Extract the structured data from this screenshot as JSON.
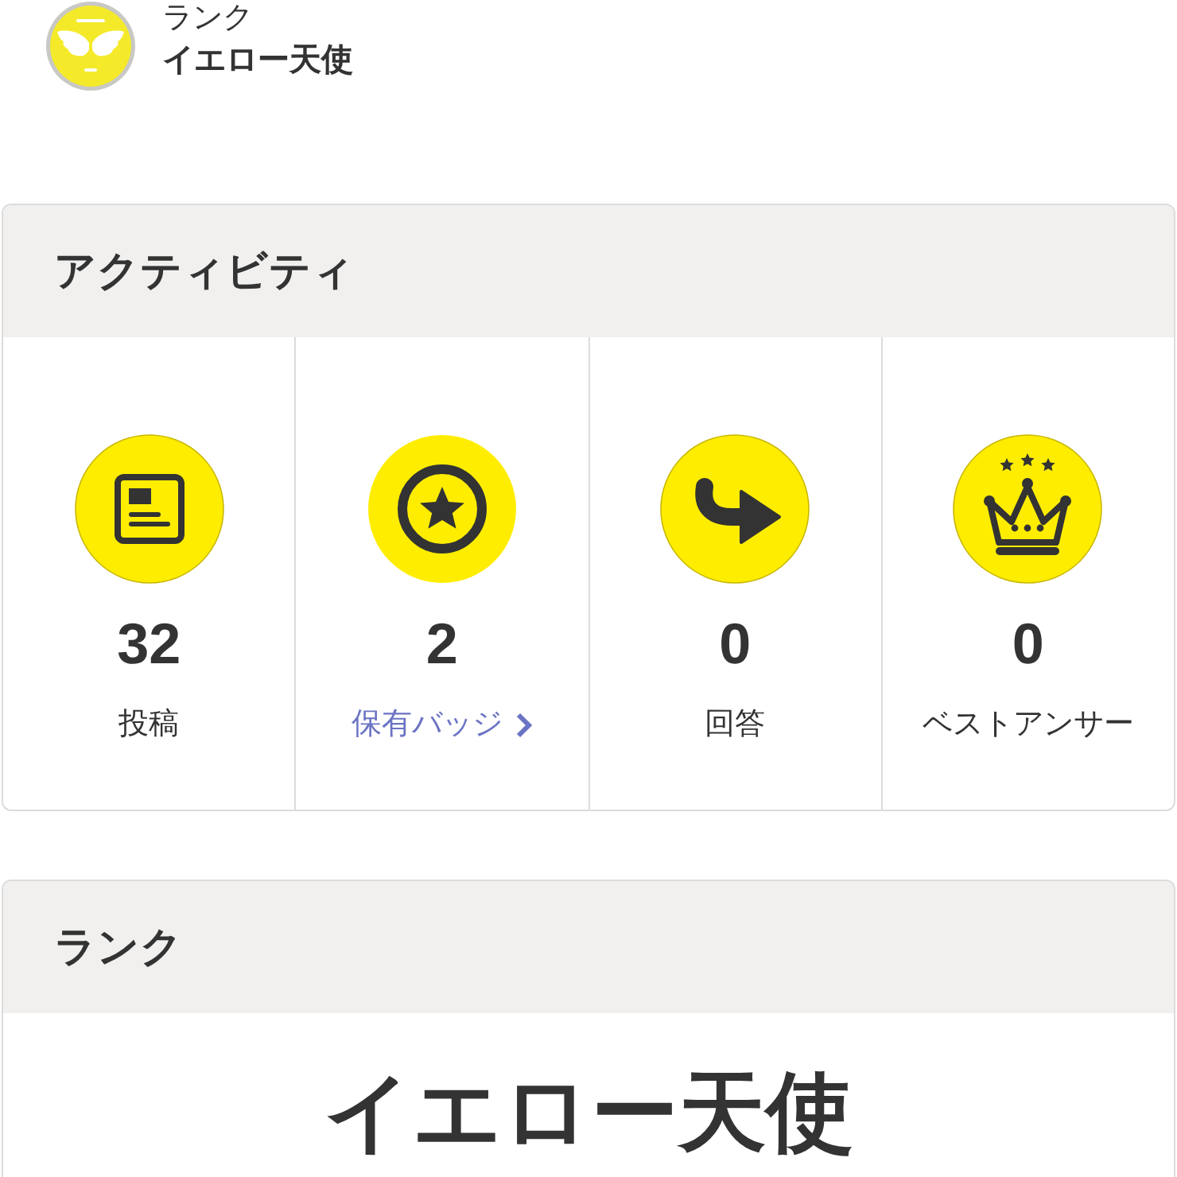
{
  "profile": {
    "rank_label": "ランク",
    "rank_name": "イエロー天使"
  },
  "activity": {
    "title": "アクティビティ",
    "stats": [
      {
        "kind": "posts",
        "value": "32",
        "label": "投稿",
        "link": false
      },
      {
        "kind": "badges",
        "value": "2",
        "label": "保有バッジ",
        "link": true
      },
      {
        "kind": "answers",
        "value": "0",
        "label": "回答",
        "link": false
      },
      {
        "kind": "best_answers",
        "value": "0",
        "label": "ベストアンサー",
        "link": false
      }
    ]
  },
  "rank": {
    "title": "ランク",
    "name": "イエロー天使"
  }
}
